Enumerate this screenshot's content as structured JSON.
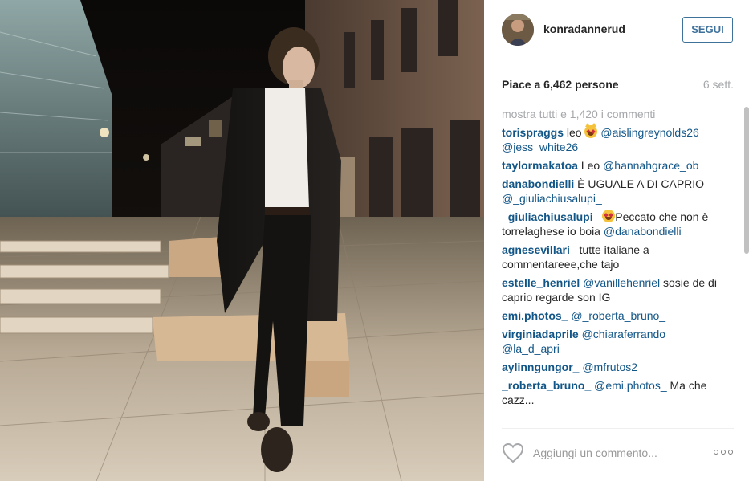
{
  "post": {
    "username": "konradannerud",
    "follow_label": "SEGUI",
    "likes": "Piace a 6,462 persone",
    "age": "6 sett.",
    "view_all": "mostra tutti e 1,420 i commenti",
    "comment_placeholder": "Aggiungi un commento...",
    "more_label": "•••"
  },
  "comments": [
    {
      "user": "torispraggs",
      "parts": [
        {
          "t": "text",
          "v": "leo "
        },
        {
          "t": "emoji",
          "v": "heart-eyes-cat"
        },
        {
          "t": "text",
          "v": " "
        },
        {
          "t": "mention",
          "v": "@aislingreynolds26"
        },
        {
          "t": "text",
          "v": " "
        },
        {
          "t": "mention",
          "v": "@jess_white26"
        }
      ]
    },
    {
      "user": "taylormakatoa",
      "parts": [
        {
          "t": "text",
          "v": "Leo "
        },
        {
          "t": "mention",
          "v": "@hannahgrace_ob"
        }
      ]
    },
    {
      "user": "danabondielli",
      "parts": [
        {
          "t": "text",
          "v": "È UGUALE A DI CAPRIO "
        },
        {
          "t": "mention",
          "v": "@_giuliachiusalupi_"
        }
      ]
    },
    {
      "user": "_giuliachiusalupi_",
      "parts": [
        {
          "t": "text",
          "v": " "
        },
        {
          "t": "emoji",
          "v": "heart-eyes"
        },
        {
          "t": "text",
          "v": "Peccato che non è torrelaghese io boia "
        },
        {
          "t": "mention",
          "v": "@danabondielli"
        }
      ]
    },
    {
      "user": "agnesevillari_",
      "parts": [
        {
          "t": "text",
          "v": "tutte italiane a commentareee,che tajo"
        }
      ]
    },
    {
      "user": "estelle_henriel",
      "parts": [
        {
          "t": "mention",
          "v": "@vanillehenriel"
        },
        {
          "t": "text",
          "v": " sosie de di caprio regarde son IG"
        }
      ]
    },
    {
      "user": "emi.photos_",
      "parts": [
        {
          "t": "mention",
          "v": "@_roberta_bruno_"
        }
      ]
    },
    {
      "user": "virginiadaprile",
      "parts": [
        {
          "t": "mention",
          "v": "@chiaraferrando_"
        },
        {
          "t": "text",
          "v": " "
        },
        {
          "t": "mention",
          "v": "@la_d_apri"
        }
      ]
    },
    {
      "user": "aylinngungor_",
      "parts": [
        {
          "t": "mention",
          "v": "@mfrutos2"
        }
      ]
    },
    {
      "user": "_roberta_bruno_",
      "parts": [
        {
          "t": "mention",
          "v": "@emi.photos_"
        },
        {
          "t": "text",
          "v": " Ma che cazz..."
        }
      ]
    }
  ],
  "colors": {
    "link": "#125688",
    "follow": "#3f729b",
    "muted": "#a5a7aa",
    "emoji": "#f5c33b"
  },
  "icons": {
    "heart": "heart-outline-icon",
    "more": "more-options-icon"
  }
}
